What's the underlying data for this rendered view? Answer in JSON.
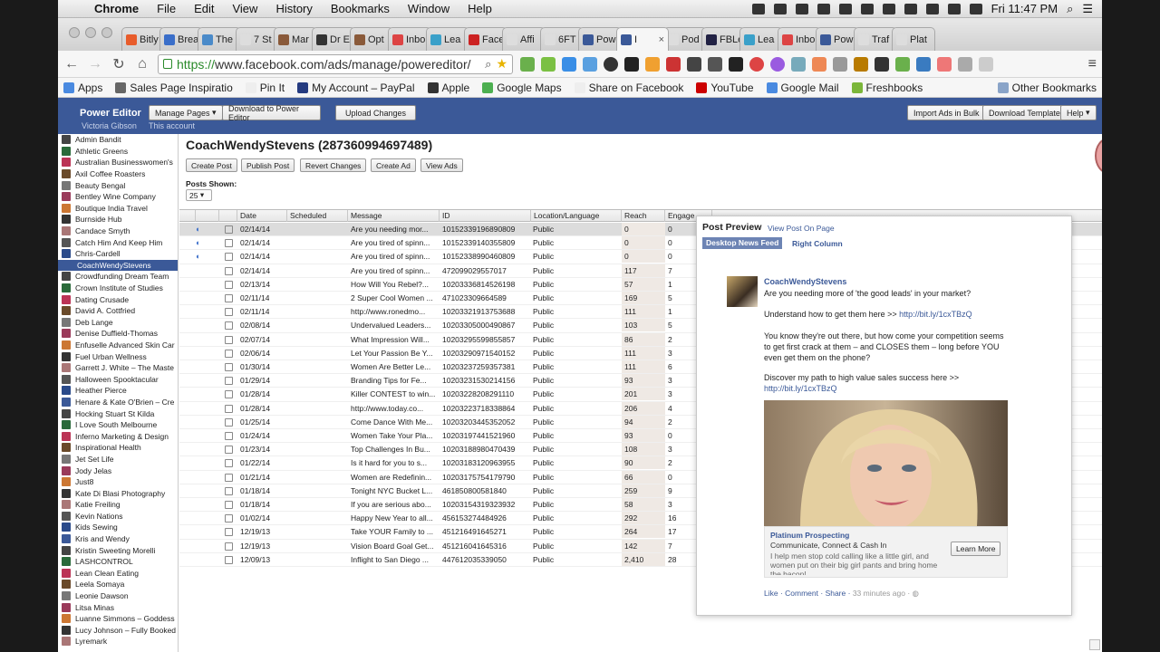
{
  "mac_menu": {
    "app": "Chrome",
    "items": [
      "File",
      "Edit",
      "View",
      "History",
      "Bookmarks",
      "Window",
      "Help"
    ],
    "clock": "Fri 11:47 PM"
  },
  "tabs": [
    {
      "label": "Bitly",
      "color": "#e85c2b"
    },
    {
      "label": "Brea",
      "color": "#3a6ec9"
    },
    {
      "label": "The",
      "color": "#4a8ac9"
    },
    {
      "label": "7 St",
      "color": "#ddd"
    },
    {
      "label": "Mar",
      "color": "#8a5a3a"
    },
    {
      "label": "Dr E",
      "color": "#333"
    },
    {
      "label": "Opt",
      "color": "#8a5a3a"
    },
    {
      "label": "Inbo",
      "color": "#d44"
    },
    {
      "label": "Lea",
      "color": "#3aa0c9"
    },
    {
      "label": "Face",
      "color": "#c22"
    },
    {
      "label": "Affi",
      "color": "#ddd"
    },
    {
      "label": "6FT",
      "color": "#ddd"
    },
    {
      "label": "Pow",
      "color": "#3b5998"
    },
    {
      "label": "I",
      "color": "#3b5998",
      "active": true
    },
    {
      "label": "Pod",
      "color": "#ddd"
    },
    {
      "label": "FBLe",
      "color": "#224"
    },
    {
      "label": "Lea",
      "color": "#3aa0c9"
    },
    {
      "label": "Inbo",
      "color": "#d44"
    },
    {
      "label": "Pow",
      "color": "#3b5998"
    },
    {
      "label": "Traf",
      "color": "#ddd"
    },
    {
      "label": "Plat",
      "color": "#ddd"
    }
  ],
  "url": {
    "scheme": "https://",
    "rest": "www.facebook.com/ads/manage/powereditor/"
  },
  "bookmarks": [
    {
      "label": "Apps",
      "color": "#4a8ae0"
    },
    {
      "label": "Sales Page Inspiratio",
      "color": "#666"
    },
    {
      "label": "Pin It",
      "color": "#eee"
    },
    {
      "label": "My Account – PayPal",
      "color": "#253b80"
    },
    {
      "label": "Apple",
      "color": "#333"
    },
    {
      "label": "Google Maps",
      "color": "#4caf50"
    },
    {
      "label": "Share on Facebook",
      "color": "#eee"
    },
    {
      "label": "YouTube",
      "color": "#c00"
    },
    {
      "label": "Google Mail",
      "color": "#4a8ae0"
    },
    {
      "label": "Freshbooks",
      "color": "#7bb63a"
    }
  ],
  "other_bookmarks": "Other Bookmarks",
  "fb": {
    "brand": "Power Editor",
    "user": "Victoria Gibson",
    "account": "This account",
    "manage_pages": "Manage Pages",
    "download": "Download to Power Editor",
    "upload": "Upload Changes",
    "import_bulk": "Import Ads in Bulk",
    "download_template": "Download Template",
    "help": "Help"
  },
  "accounts": [
    "Admin Bandit",
    "Athletic Greens",
    "Australian Businesswomen's",
    "Axil Coffee Roasters",
    "Beauty Bengal",
    "Bentley Wine Company",
    "Boutique India Travel",
    "Burnside Hub",
    "Candace Smyth",
    "Catch Him And Keep Him",
    "Chris-Cardell",
    "CoachWendyStevens",
    "Crowdfunding Dream Team",
    "Crown Institute of Studies",
    "Dating Crusade",
    "David A. Cottfried",
    "Deb Lange",
    "Denise Duffield-Thomas",
    "Enfuselle Advanced Skin Car",
    "Fuel Urban Wellness",
    "Garrett J. White – The Maste",
    "Halloween Spooktacular",
    "Heather Pierce",
    "Henare & Kate O'Brien – Cre",
    "Hocking Stuart St Kilda",
    "I Love South Melbourne",
    "Inferno Marketing & Design",
    "Inspirational Health",
    "Jet Set Life",
    "Jody Jelas",
    "Just8",
    "Kate Di Blasi Photography",
    "Katie Freiling",
    "Kevin Nations",
    "Kids Sewing",
    "Kris and Wendy",
    "Kristin Sweeting Morelli",
    "LASHCONTROL",
    "Lean Clean Eating",
    "Leela Somaya",
    "Leonie Dawson",
    "Litsa Minas",
    "Luanne Simmons – Goddess",
    "Lucy Johnson – Fully Booked",
    "Lyremark"
  ],
  "selected_account": "CoachWendyStevens",
  "page_title": "CoachWendyStevens (287360994697489)",
  "actions": [
    "Create Post",
    "Publish Post",
    "Revert Changes",
    "Create Ad",
    "View Ads"
  ],
  "posts_shown_label": "Posts Shown:",
  "posts_shown_value": "25",
  "columns": [
    "Date",
    "Scheduled",
    "Message",
    "ID",
    "Location/Language",
    "Reach",
    "Engage"
  ],
  "rows": [
    {
      "date": "02/14/14",
      "msg": "Are you needing mor...",
      "id": "10152339196890809",
      "loc": "Public",
      "reach": "0",
      "eng": "0",
      "sched": true
    },
    {
      "date": "02/14/14",
      "msg": "Are you tired of spinn...",
      "id": "10152339140355809",
      "loc": "Public",
      "reach": "0",
      "eng": "0",
      "sched": true
    },
    {
      "date": "02/14/14",
      "msg": "Are you tired of spinn...",
      "id": "10152338990460809",
      "loc": "Public",
      "reach": "0",
      "eng": "0",
      "sched": true
    },
    {
      "date": "02/14/14",
      "msg": "Are you tired of spinn...",
      "id": "472099029557017",
      "loc": "Public",
      "reach": "117",
      "eng": "7"
    },
    {
      "date": "02/13/14",
      "msg": "How Will You Rebel?...",
      "id": "10203336814526198",
      "loc": "Public",
      "reach": "57",
      "eng": "1"
    },
    {
      "date": "02/11/14",
      "msg": "2 Super Cool Women ...",
      "id": "471023309664589",
      "loc": "Public",
      "reach": "169",
      "eng": "5"
    },
    {
      "date": "02/11/14",
      "msg": "http://www.ronedmo...",
      "id": "10203321913753688",
      "loc": "Public",
      "reach": "111",
      "eng": "1"
    },
    {
      "date": "02/08/14",
      "msg": "Undervalued Leaders...",
      "id": "10203305000490867",
      "loc": "Public",
      "reach": "103",
      "eng": "5"
    },
    {
      "date": "02/07/14",
      "msg": "What Impression Will...",
      "id": "10203295599855857",
      "loc": "Public",
      "reach": "86",
      "eng": "2"
    },
    {
      "date": "02/06/14",
      "msg": "Let Your Passion Be Y...",
      "id": "10203290971540152",
      "loc": "Public",
      "reach": "111",
      "eng": "3"
    },
    {
      "date": "01/30/14",
      "msg": "Women Are Better Le...",
      "id": "10203237259357381",
      "loc": "Public",
      "reach": "111",
      "eng": "6"
    },
    {
      "date": "01/29/14",
      "msg": "Branding Tips for Fe...",
      "id": "10203231530214156",
      "loc": "Public",
      "reach": "93",
      "eng": "3"
    },
    {
      "date": "01/28/14",
      "msg": "Killer CONTEST to win...",
      "id": "10203228208291110",
      "loc": "Public",
      "reach": "201",
      "eng": "3"
    },
    {
      "date": "01/28/14",
      "msg": "http://www.today.co...",
      "id": "10203223718338864",
      "loc": "Public",
      "reach": "206",
      "eng": "4"
    },
    {
      "date": "01/25/14",
      "msg": "Come Dance With Me...",
      "id": "10203203445352052",
      "loc": "Public",
      "reach": "94",
      "eng": "2"
    },
    {
      "date": "01/24/14",
      "msg": "Women Take Your Pla...",
      "id": "10203197441521960",
      "loc": "Public",
      "reach": "93",
      "eng": "0"
    },
    {
      "date": "01/23/14",
      "msg": "Top Challenges In Bu...",
      "id": "10203188980470439",
      "loc": "Public",
      "reach": "108",
      "eng": "3"
    },
    {
      "date": "01/22/14",
      "msg": "Is it hard for you to s...",
      "id": "10203183120963955",
      "loc": "Public",
      "reach": "90",
      "eng": "2"
    },
    {
      "date": "01/21/14",
      "msg": "Women are Redefinin...",
      "id": "10203175754179790",
      "loc": "Public",
      "reach": "66",
      "eng": "0"
    },
    {
      "date": "01/18/14",
      "msg": "Tonight NYC Bucket L...",
      "id": "461850800581840",
      "loc": "Public",
      "reach": "259",
      "eng": "9"
    },
    {
      "date": "01/18/14",
      "msg": "If you are serious abo...",
      "id": "10203154319323932",
      "loc": "Public",
      "reach": "58",
      "eng": "3"
    },
    {
      "date": "01/02/14",
      "msg": "Happy New Year to all...",
      "id": "456153274484926",
      "loc": "Public",
      "reach": "292",
      "eng": "16"
    },
    {
      "date": "12/19/13",
      "msg": "Take YOUR Family to ...",
      "id": "451216491645271",
      "loc": "Public",
      "reach": "264",
      "eng": "17"
    },
    {
      "date": "12/19/13",
      "msg": "Vision Board Goal Get...",
      "id": "451216041645316",
      "loc": "Public",
      "reach": "142",
      "eng": "7"
    },
    {
      "date": "12/09/13",
      "msg": "Inflight to San Diego ...",
      "id": "447612035339050",
      "loc": "Public",
      "reach": "2,410",
      "eng": "28"
    }
  ],
  "preview": {
    "title": "Post Preview",
    "view_link": "View Post On Page",
    "tab_active": "Desktop News Feed",
    "tab_other": "Right Column",
    "name": "CoachWendyStevens",
    "line1": "Are you needing more of 'the good leads' in your market?",
    "line2a": "Understand how to get them here >> ",
    "line2b": "http://bit.ly/1cxTBzQ",
    "line3": "You know they're out there, but how come your competition seems to get first crack at them – and CLOSES them – long before YOU even get them on the phone?",
    "line4": "Discover my path to high value sales success here >>",
    "line4b": "http://bit.ly/1cxTBzQ",
    "ad_title": "Platinum Prospecting",
    "ad_sub": "Communicate, Connect & Cash In",
    "ad_body": "I help men stop cold calling like a little girl, and women put on their big girl pants and bring home the bacon!",
    "ad_btn": "Learn More",
    "foot_like": "Like",
    "foot_comment": "Comment",
    "foot_share": "Share",
    "foot_time": "33 minutes ago"
  }
}
